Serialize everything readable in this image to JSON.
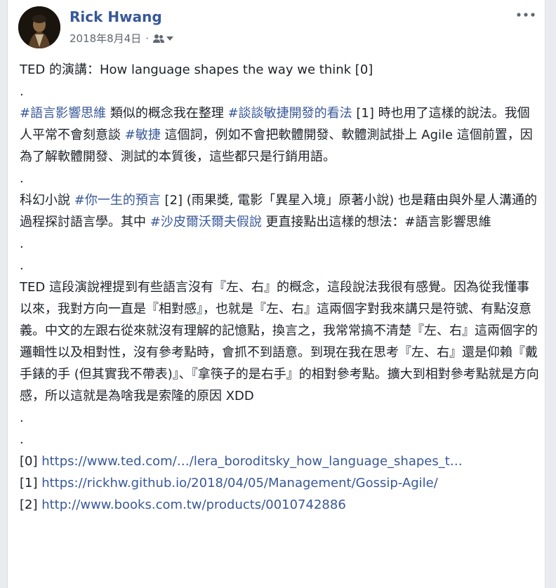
{
  "author": {
    "name": "Rick Hwang"
  },
  "meta": {
    "date": "2018年8月4日",
    "separator": "·"
  },
  "icons": {
    "audience": "friends-icon",
    "dropdown": "chevron-down-icon",
    "more": "more-dots-icon"
  },
  "colors": {
    "link": "#385898",
    "text": "#1d2129",
    "meta": "#616770"
  },
  "post": {
    "l1": "TED 的演講：How language shapes the way we think [0]",
    "d1": ".",
    "p2": {
      "tag1": "#語言影響思維",
      "t1": " 類似的概念我在整理 ",
      "tag2": "#談談敏捷開發的看法",
      "t2": " [1] 時也用了這樣的說法。我個人平常不會刻意談 ",
      "tag3": "#敏捷",
      "t3": " 這個詞，例如不會把軟體開發、軟體測試掛上 Agile 這個前置，因為了解軟體開發、測試的本質後，這些都只是行銷用語。"
    },
    "d2": ".",
    "p3": {
      "t1": "科幻小說 ",
      "tag1": "#你一生的預言",
      "t2": " [2] (雨果獎, 電影「異星入境」原著小說) 也是藉由與外星人溝通的過程探討語言學。其中 ",
      "tag2": "#沙皮爾沃爾夫假說",
      "t3": " 更直接點出這樣的想法：#語言影響思維"
    },
    "d3": ".",
    "d4": ".",
    "p4": "TED 這段演說裡提到有些語言沒有『左、右』的概念，這段說法我很有感覺。因為從我懂事以來，我對方向一直是『相對感』，也就是『左、右』這兩個字對我來講只是符號、有點沒意義。中文的左跟右從來就沒有理解的記憶點，換言之，我常常搞不清楚『左、右』這兩個字的邏輯性以及相對性，沒有參考點時，會抓不到語意。到現在我在思考『左、右』還是仰賴『戴手錶的手 (但其實我不帶表)』、『拿筷子的是右手』的相對參考點。擴大到相對參考點就是方向感，所以這就是為啥我是索隆的原因 XDD",
    "d5": ".",
    "d6": ".",
    "refs": [
      {
        "label": "[0] ",
        "url": "https://www.ted.com/…/lera_boroditsky_how_language_shapes_t…"
      },
      {
        "label": "[1] ",
        "url": "https://rickhw.github.io/2018/04/05/Management/Gossip-Agile/"
      },
      {
        "label": "[2] ",
        "url": "http://www.books.com.tw/products/0010742886"
      }
    ]
  }
}
